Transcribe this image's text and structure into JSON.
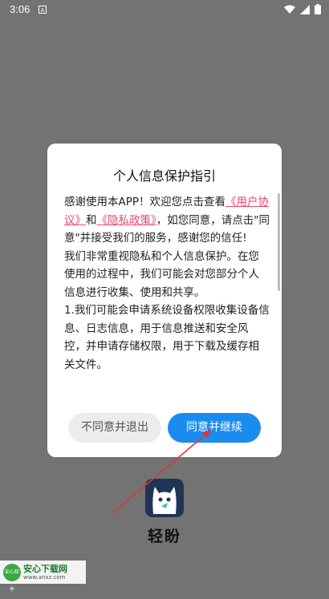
{
  "status_bar": {
    "time": "3:06",
    "icons": [
      "notification-a-icon",
      "wifi-icon",
      "signal-icon",
      "battery-icon"
    ]
  },
  "dialog": {
    "title": "个人信息保护指引",
    "body": {
      "p1_prefix": "感谢使用本APP！欢迎您点击查看",
      "link_user_agreement": "《用户协议》",
      "p1_and": "和",
      "link_privacy_policy": "《隐私政策》",
      "p1_suffix": "，如您同意，请点击\"同意\"并接受我们的服务，感谢您的信任!",
      "p2": "我们非常重视隐私和个人信息保护。在您使用的过程中，我们可能会对您部分个人信息进行收集、使用和共享。",
      "p3": "1.我们可能会申请系统设备权限收集设备信息、日志信息，用于信息推送和安全风控，并申请存储权限，用于下载及缓存相关文件。"
    },
    "decline_label": "不同意并退出",
    "agree_label": "同意并继续"
  },
  "app": {
    "name": "轻盼"
  },
  "watermark": {
    "logo_text": "安心软件",
    "title": "安心下载网",
    "url": "www.anxz.com"
  },
  "colors": {
    "overlay": "#737373",
    "accent": "#1a8cf0",
    "link": "#e64a6b",
    "arrow": "#e03535"
  }
}
